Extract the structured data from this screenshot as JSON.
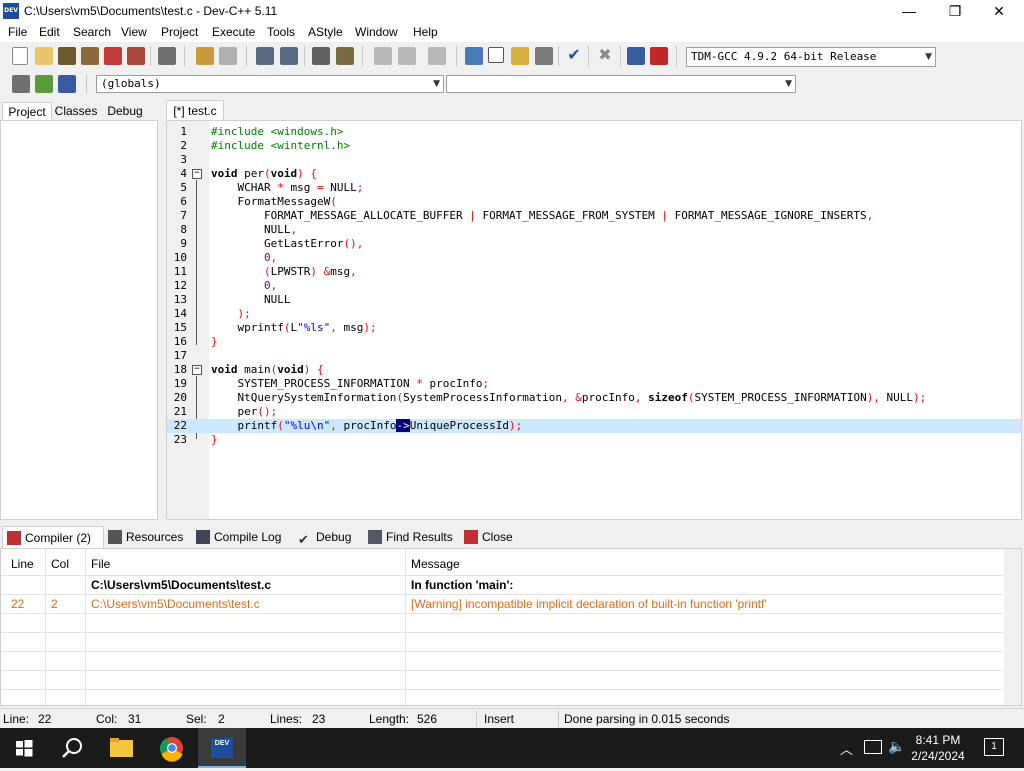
{
  "window": {
    "title": "C:\\Users\\vm5\\Documents\\test.c - Dev-C++ 5.11",
    "app_icon_text": "DEV",
    "minimize": "—",
    "restore": "❐",
    "close": "✕"
  },
  "menu": [
    "File",
    "Edit",
    "Search",
    "View",
    "Project",
    "Execute",
    "Tools",
    "AStyle",
    "Window",
    "Help"
  ],
  "toolbar": {
    "compiler_select": "TDM-GCC 4.9.2 64-bit Release",
    "scope_select": "(globals)",
    "function_select": ""
  },
  "left_tabs": [
    "Project",
    "Classes",
    "Debug"
  ],
  "editor_tab": "[*] test.c",
  "code": {
    "lines": [
      {
        "n": "1",
        "fold": ""
      },
      {
        "n": "2",
        "fold": ""
      },
      {
        "n": "3",
        "fold": ""
      },
      {
        "n": "4",
        "fold": "−"
      },
      {
        "n": "5",
        "fold": ""
      },
      {
        "n": "6",
        "fold": ""
      },
      {
        "n": "7",
        "fold": ""
      },
      {
        "n": "8",
        "fold": ""
      },
      {
        "n": "9",
        "fold": ""
      },
      {
        "n": "10",
        "fold": ""
      },
      {
        "n": "11",
        "fold": ""
      },
      {
        "n": "12",
        "fold": ""
      },
      {
        "n": "13",
        "fold": ""
      },
      {
        "n": "14",
        "fold": ""
      },
      {
        "n": "15",
        "fold": ""
      },
      {
        "n": "16",
        "fold": ""
      },
      {
        "n": "17",
        "fold": ""
      },
      {
        "n": "18",
        "fold": "−"
      },
      {
        "n": "19",
        "fold": ""
      },
      {
        "n": "20",
        "fold": ""
      },
      {
        "n": "21",
        "fold": ""
      },
      {
        "n": "22",
        "fold": ""
      },
      {
        "n": "23",
        "fold": ""
      }
    ],
    "l1": [
      "#include <windows.h>"
    ],
    "l2": [
      "#include <winternl.h>"
    ],
    "l4": [
      "void",
      " per",
      "(",
      "void",
      ")",
      " {"
    ],
    "l5": [
      "    WCHAR ",
      "*",
      " msg ",
      "=",
      " NULL",
      ";"
    ],
    "l6": [
      "    FormatMessageW",
      "("
    ],
    "l7": [
      "        FORMAT_MESSAGE_ALLOCATE_BUFFER ",
      "|",
      " FORMAT_MESSAGE_FROM_SYSTEM ",
      "|",
      " FORMAT_MESSAGE_IGNORE_INSERTS",
      ","
    ],
    "l8": [
      "        NULL",
      ","
    ],
    "l9": [
      "        GetLastError",
      "(),"
    ],
    "l10": [
      "        ",
      "0",
      ","
    ],
    "l11": [
      "        ",
      "(",
      "LPWSTR",
      ")",
      " ",
      "&",
      "msg",
      ","
    ],
    "l12": [
      "        ",
      "0",
      ","
    ],
    "l13": [
      "        NULL"
    ],
    "l14": [
      "    ",
      ");"
    ],
    "l15": [
      "    wprintf",
      "(",
      "L",
      "\"%ls\"",
      ",",
      " msg",
      ");"
    ],
    "l16": [
      "}"
    ],
    "l18": [
      "void",
      " main",
      "(",
      "void",
      ")",
      " {"
    ],
    "l19": [
      "    SYSTEM_PROCESS_INFORMATION ",
      "*",
      " procInfo",
      ";"
    ],
    "l20": [
      "    NtQuerySystemInformation",
      "(",
      "SystemProcessInformation",
      ",",
      " ",
      "&",
      "procInfo",
      ",",
      " ",
      "sizeof",
      "(",
      "SYSTEM_PROCESS_INFORMATION",
      "),",
      " NULL",
      ");"
    ],
    "l21": [
      "    per",
      "();"
    ],
    "l22": [
      "    printf",
      "(",
      "\"%lu\\n\"",
      ",",
      " procInfo",
      "->",
      "UniqueProcessId",
      ");"
    ],
    "l23": [
      "}"
    ]
  },
  "bottom_tabs": [
    "Compiler (2)",
    "Resources",
    "Compile Log",
    "Debug",
    "Find Results",
    "Close"
  ],
  "compiler": {
    "headers": {
      "line": "Line",
      "col": "Col",
      "file": "File",
      "message": "Message"
    },
    "rows": [
      {
        "line": "",
        "col": "",
        "file": "C:\\Users\\vm5\\Documents\\test.c",
        "message": "In function 'main':",
        "type": "info"
      },
      {
        "line": "22",
        "col": "2",
        "file": "C:\\Users\\vm5\\Documents\\test.c",
        "message": "[Warning] incompatible implicit declaration of built-in function 'printf'",
        "type": "warning"
      }
    ]
  },
  "status": {
    "line_label": "Line:",
    "line": "22",
    "col_label": "Col:",
    "col": "31",
    "sel_label": "Sel:",
    "sel": "2",
    "lines_label": "Lines:",
    "lines": "23",
    "length_label": "Length:",
    "length": "526",
    "mode": "Insert",
    "message": "Done parsing in 0.015 seconds"
  },
  "taskbar": {
    "time": "8:41 PM",
    "date": "2/24/2024",
    "notifications": "1"
  },
  "colors": {
    "warning": "#e06a1a",
    "current_line": "#cce8ff",
    "selection": "#000080",
    "string": "#0000ff",
    "symbol": "#ff0000",
    "number": "#800080",
    "preprocessor": "#008000"
  }
}
